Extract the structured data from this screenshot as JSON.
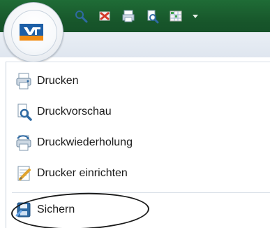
{
  "app": {
    "logo_icon": "vr-bank-logo",
    "colors": {
      "ribbon_green": "#1f6c36",
      "logo_blue": "#1d5fa6",
      "logo_orange": "#f28c12",
      "menu_text": "#1a1a1a"
    }
  },
  "quick_access_toolbar": {
    "items": [
      {
        "icon": "search-icon"
      },
      {
        "icon": "cancel-icon"
      },
      {
        "icon": "print-icon"
      },
      {
        "icon": "print-preview-icon"
      },
      {
        "icon": "grid-edit-icon"
      },
      {
        "icon": "dropdown-icon"
      }
    ]
  },
  "menu": {
    "items": [
      {
        "label": "Drucken",
        "icon": "printer-icon"
      },
      {
        "label": "Druckvorschau",
        "icon": "print-preview-icon"
      },
      {
        "label": "Druckwiederholung",
        "icon": "reprint-icon"
      },
      {
        "label": "Drucker einrichten",
        "icon": "printer-setup-icon"
      },
      {
        "label": "Sichern",
        "icon": "save-icon"
      }
    ]
  }
}
